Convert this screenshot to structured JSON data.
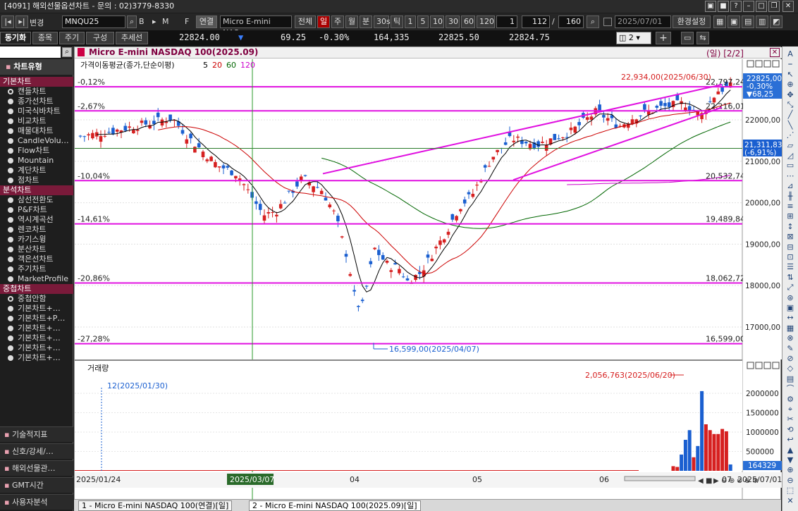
{
  "window": {
    "title": "[4091] 해외선물옵션차트 - 문의 : 02)3779-8330"
  },
  "toolbar": {
    "change_label": "변경",
    "symbol": "MNQU25",
    "symbol_name": "Micro E-mini NAS",
    "link_label": "연결",
    "all_label": "전체",
    "periods": [
      "일",
      "주",
      "월",
      "분",
      "30s",
      "틱"
    ],
    "intervals": [
      "1",
      "5",
      "10",
      "30",
      "60",
      "120"
    ],
    "num1": "1",
    "count": "112",
    "slash": "/",
    "total": "160",
    "date": "2025/07/01",
    "settings_label": "환경설정",
    "b_label": "B",
    "m_label": "M",
    "f_label": "F"
  },
  "toolbar2": {
    "tabs": [
      "동기화",
      "종목",
      "주기",
      "구성",
      "추세선"
    ],
    "price": "22824.00",
    "arrow": "▼",
    "change": "69.25",
    "change_pct": "-0.30%",
    "volume": "164,335",
    "ask": "22825.50",
    "bid": "22824.75",
    "layout_count": "2"
  },
  "sidebar": {
    "chart_type_label": "차트유형",
    "sections": [
      {
        "title": "기본차트",
        "items": [
          "캔들차트",
          "종가선차트",
          "미국식바차트",
          "비교차트",
          "매물대차트",
          "CandleVolu…",
          "Flow차트",
          "Mountain",
          "계단차트",
          "점차트"
        ]
      },
      {
        "title": "분석차트",
        "items": [
          "삼선전환도",
          "P&F차트",
          "역시계곡선",
          "렌코차트",
          "카기스윙",
          "분산차트",
          "객은선차트",
          "주기차트",
          "MarketProfile"
        ]
      },
      {
        "title": "중첩차트",
        "items": [
          "중첩안함",
          "기본차트+…",
          "기본차트+P…",
          "기본차트+…",
          "기본차트+…",
          "기본차트+…",
          "기본차트+…"
        ]
      }
    ],
    "bottom": [
      "기술적지표",
      "신호/강세/…",
      "해외선물관…",
      "GMT시간",
      "사용자분석"
    ]
  },
  "chart": {
    "title": "Micro E-mini NASDAQ 100(2025.09)",
    "period_tag": "(일) [2/2]",
    "ma_legend": "가격이동평균(종가,단순이평)",
    "ma_periods": [
      "5",
      "20",
      "60",
      "120"
    ],
    "ma_colors": [
      "#000000",
      "#cc0000",
      "#006600",
      "#cc00cc"
    ],
    "price_tick_labels": [
      "22000,00",
      "21000,00",
      "20000,00",
      "19000,00",
      "18000,00",
      "17000,00"
    ],
    "pct_labels": [
      "-0,12%",
      "-2,67%",
      "-10,04%",
      "-14,61%",
      "-20,86%",
      "-27,28%"
    ],
    "level_labels": [
      "22,797,24",
      "22,216,01",
      "20,532,74",
      "19,489,84",
      "18,062,72",
      "16,599,00"
    ],
    "high_annotation": "22,934,00(2025/06/30)",
    "low_annotation": "16,599,00(2025/04/07)",
    "current_box": [
      "22825,00",
      "-0,30%",
      "▼68,25"
    ],
    "ref_box": [
      "21,311,83",
      "(-6,91%)"
    ],
    "volume_title": "거래량",
    "volume_ticks": [
      "2000000",
      "1500000",
      "1000000",
      "500000"
    ],
    "volume_current": "164329",
    "volume_max_annotation": "2,056,763(2025/06/20)",
    "volume_min_annotation": "12(2025/01/30)",
    "x_labels": [
      "2025/01/24",
      "2025/03/07",
      "04",
      "05",
      "06",
      "07",
      "2025/07/01"
    ]
  },
  "chart_data": {
    "type": "candlestick",
    "title": "Micro E-mini NASDAQ 100(2025.09)",
    "period": "일",
    "horizontal_levels": [
      22797.24,
      22216.01,
      20532.74,
      19489.84,
      18062.72,
      16599.0
    ],
    "high": {
      "value": 22934.0,
      "date": "2025/06/30"
    },
    "low": {
      "value": 16599.0,
      "date": "2025/04/07"
    },
    "last": {
      "price": 22825.0,
      "change": -68.25,
      "change_pct": -0.3
    },
    "volume": {
      "max": {
        "value": 2056763,
        "date": "2025/06/20"
      },
      "min": {
        "value": 12,
        "date": "2025/01/30"
      },
      "last": 164329
    },
    "ylim": [
      16500,
      23000
    ]
  },
  "bottom_tabs": [
    "1 - Micro E-mini NASDAQ 100(연결)[일]",
    "2 - Micro E-mini NASDAQ 100(2025.09)[일]"
  ]
}
